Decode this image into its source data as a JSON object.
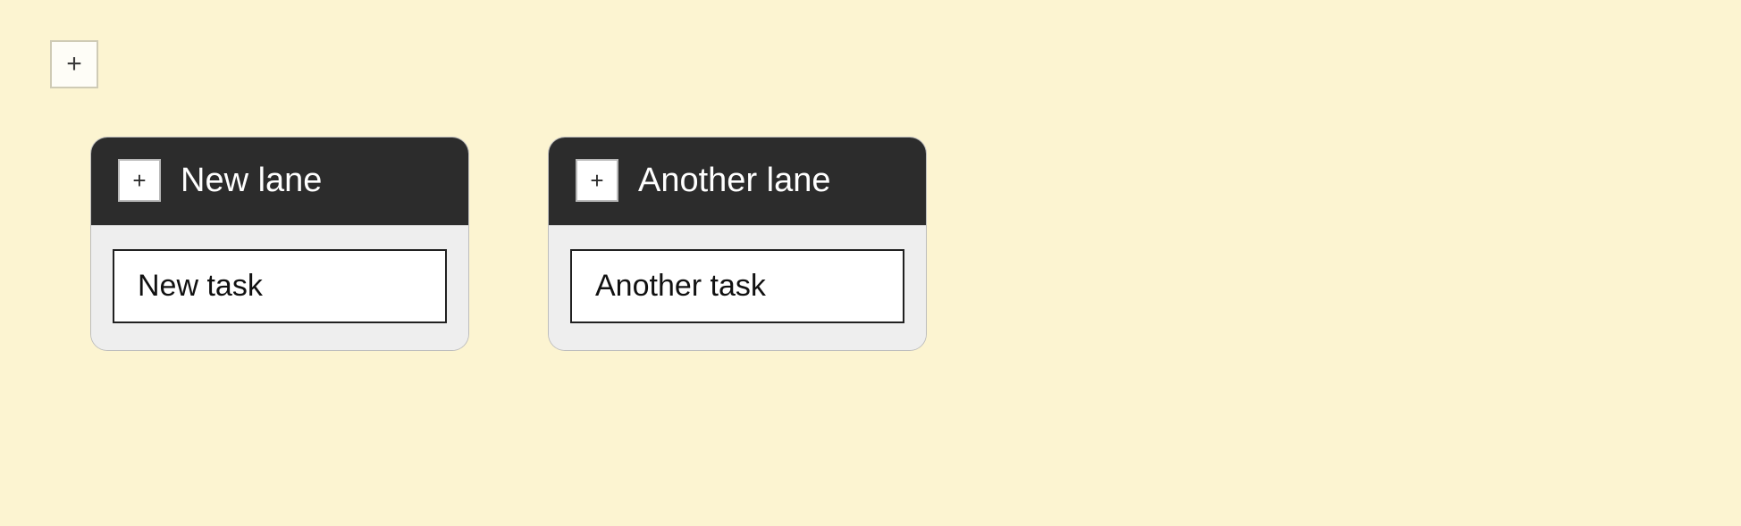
{
  "board": {
    "add_lane_icon": "+",
    "lanes": [
      {
        "add_task_icon": "+",
        "title": "New lane",
        "tasks": [
          {
            "title": "New task"
          }
        ]
      },
      {
        "add_task_icon": "+",
        "title": "Another lane",
        "tasks": [
          {
            "title": "Another task"
          }
        ]
      }
    ]
  }
}
